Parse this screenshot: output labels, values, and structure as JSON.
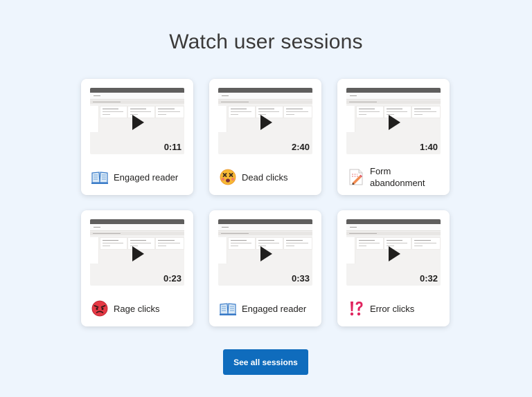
{
  "title": "Watch user sessions",
  "sessions": [
    {
      "duration": "0:11",
      "label": "Engaged reader",
      "icon": "book-icon"
    },
    {
      "duration": "2:40",
      "label": "Dead clicks",
      "icon": "dizzy-face-icon"
    },
    {
      "duration": "1:40",
      "label": "Form abandonment",
      "icon": "form-pencil-icon"
    },
    {
      "duration": "0:23",
      "label": "Rage clicks",
      "icon": "angry-face-icon"
    },
    {
      "duration": "0:33",
      "label": "Engaged reader",
      "icon": "book-icon"
    },
    {
      "duration": "0:32",
      "label": "Error clicks",
      "icon": "exclamation-question-icon"
    }
  ],
  "button": {
    "label": "See all sessions",
    "color": "#0f6cbd"
  }
}
